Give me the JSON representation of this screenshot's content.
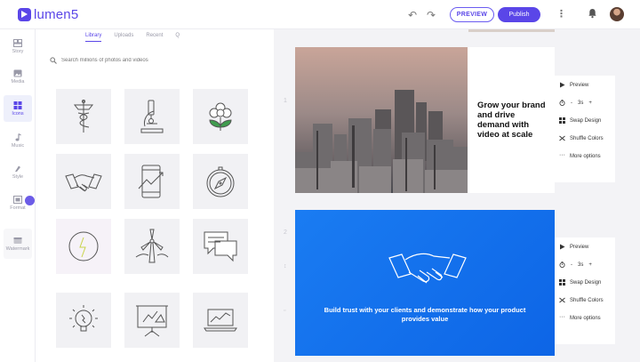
{
  "header": {
    "logo_text": "lumen5",
    "undo_icon": "undo-icon",
    "redo_icon": "redo-icon",
    "preview_label": "PREVIEW",
    "publish_label": "Publish",
    "accent": "#5a46e8"
  },
  "rail": {
    "items": [
      {
        "label": "Story",
        "icon": "story-icon"
      },
      {
        "label": "Media",
        "icon": "media-icon"
      },
      {
        "label": "Icons",
        "icon": "icons-icon"
      },
      {
        "label": "Music",
        "icon": "music-icon"
      },
      {
        "label": "Style",
        "icon": "style-icon"
      },
      {
        "label": "Format",
        "icon": "format-icon"
      },
      {
        "label": "Watermark",
        "icon": "watermark-icon"
      }
    ],
    "active": "Icons"
  },
  "library": {
    "tabs": [
      "Library",
      "Uploads",
      "Recent",
      "Q"
    ],
    "active_tab": "Library",
    "search_placeholder": "Search millions of photos and videos",
    "icons": [
      "caduceus-icon",
      "microscope-icon",
      "flower-icon",
      "handshake-icon",
      "mobile-growth-icon",
      "compass-icon",
      "lightning-globe-icon",
      "wind-turbine-icon",
      "chat-bubbles-icon",
      "lightbulb-icon",
      "presentation-board-icon",
      "laptop-chart-icon"
    ]
  },
  "scenes": [
    {
      "number": "1",
      "headline": "Grow your brand and drive demand with video at scale",
      "background": "city-skyline-photo",
      "options": {
        "preview": "Preview",
        "duration": "3s",
        "swap_design": "Swap Design",
        "shuffle_colors": "Shuffle Colors",
        "more_options": "More options"
      }
    },
    {
      "number": "2",
      "headline": "Build trust with your clients and demonstrate how your product provides value",
      "background_color": "#1a7cf2",
      "icon": "handshake-icon",
      "options": {
        "preview": "Preview",
        "duration": "3s",
        "swap_design": "Swap Design",
        "shuffle_colors": "Shuffle Colors",
        "more_options": "More options"
      }
    }
  ]
}
